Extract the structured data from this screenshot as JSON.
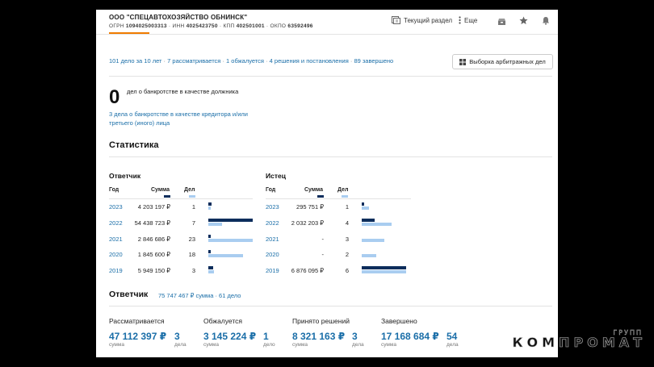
{
  "company": {
    "name": "ООО \"СПЕЦАВТОХОЗЯЙСТВО ОБНИНСК\"",
    "ogrn_label": "ОГРН",
    "ogrn": "1094025003313",
    "inn_label": "ИНН",
    "inn": "4025423750",
    "kpp_label": "КПП",
    "kpp": "402501001",
    "okpo_label": "ОКПО",
    "okpo": "63592496"
  },
  "toolbar": {
    "current_section": "Текущий раздел",
    "more": "Еще"
  },
  "summary": {
    "total": "101 дело за 10 лет",
    "considering": "7 рассматривается",
    "appealed": "1 обжалуется",
    "decisions": "4 решения и постановления",
    "finished": "89 завершено",
    "button": "Выборка арбитражных дел"
  },
  "bankruptcy": {
    "count": "0",
    "desc": "дел о банкротстве в качестве должника",
    "creditor_link": "3 дела о банкротстве в качестве кредитора и/или третьего (иного) лица"
  },
  "statistics": {
    "title": "Статистика",
    "col_year": "Год",
    "col_sum": "Сумма",
    "col_count": "Дел",
    "defendant": {
      "title": "Ответчик",
      "rows": [
        {
          "year": "2023",
          "sum": "4 203 197 ₽",
          "count": "1",
          "sum_frac": 0.077,
          "count_frac": 0.043
        },
        {
          "year": "2022",
          "sum": "54 438 723 ₽",
          "count": "7",
          "sum_frac": 1.0,
          "count_frac": 0.304
        },
        {
          "year": "2021",
          "sum": "2 846 686 ₽",
          "count": "23",
          "sum_frac": 0.052,
          "count_frac": 1.0
        },
        {
          "year": "2020",
          "sum": "1 845 600 ₽",
          "count": "18",
          "sum_frac": 0.034,
          "count_frac": 0.783
        },
        {
          "year": "2019",
          "sum": "5 949 150 ₽",
          "count": "3",
          "sum_frac": 0.109,
          "count_frac": 0.13
        }
      ]
    },
    "plaintiff": {
      "title": "Истец",
      "rows": [
        {
          "year": "2023",
          "sum": "295 751 ₽",
          "count": "1",
          "sum_frac": 0.043,
          "count_frac": 0.167
        },
        {
          "year": "2022",
          "sum": "2 032 203 ₽",
          "count": "4",
          "sum_frac": 0.296,
          "count_frac": 0.667
        },
        {
          "year": "2021",
          "sum": "-",
          "count": "3",
          "sum_frac": 0,
          "count_frac": 0.5
        },
        {
          "year": "2020",
          "sum": "-",
          "count": "2",
          "sum_frac": 0,
          "count_frac": 0.333
        },
        {
          "year": "2019",
          "sum": "6 876 095 ₽",
          "count": "6",
          "sum_frac": 1.0,
          "count_frac": 1.0
        }
      ]
    }
  },
  "respondent": {
    "title": "Ответчик",
    "info": "75 747 467 ₽ сумма · 61 дело",
    "stats": [
      {
        "label": "Рассматривается",
        "sum": "47 112 397 ₽",
        "count": "3",
        "sum_sub": "сумма",
        "count_sub": "дела"
      },
      {
        "label": "Обжалуется",
        "sum": "3 145 224 ₽",
        "count": "1",
        "sum_sub": "сумма",
        "count_sub": "дело"
      },
      {
        "label": "Принято решений",
        "sum": "8 321 163 ₽",
        "count": "3",
        "sum_sub": "сумма",
        "count_sub": "дела"
      },
      {
        "label": "Завершено",
        "sum": "17 168 684 ₽",
        "count": "54",
        "sum_sub": "сумма",
        "count_sub": "дела"
      }
    ]
  },
  "watermark": {
    "small": "ГРУПП",
    "big": "КОМПРОМАТ"
  },
  "colors": {
    "accent": "#f07c00",
    "link": "#1a6ea8",
    "bar_dark": "#0c2d5c",
    "bar_light": "#a9cdf0"
  }
}
